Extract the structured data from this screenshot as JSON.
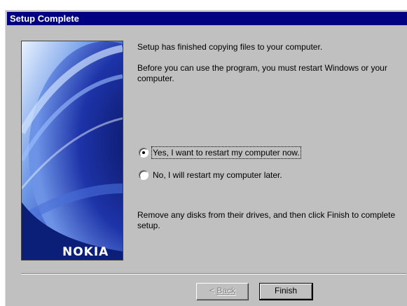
{
  "window": {
    "title": "Setup Complete"
  },
  "branding": {
    "logo_text": "NOKIA"
  },
  "content": {
    "line1": "Setup has finished copying files to your computer.",
    "line2": "Before you can use the program, you must restart Windows or your computer.",
    "line3": "Remove any disks from their drives, and then click Finish to complete setup."
  },
  "options": [
    {
      "label": "Yes, I want to restart my computer now.",
      "selected": true
    },
    {
      "label": "No, I will restart my computer later.",
      "selected": false
    }
  ],
  "buttons": {
    "back_prefix": "< ",
    "back_label": "Back",
    "finish_label": "Finish"
  },
  "colors": {
    "titlebar": "#000080",
    "dialog_bg": "#c0c0c0",
    "image_dark": "#0a1a6a",
    "image_light": "#c8e0ff"
  }
}
